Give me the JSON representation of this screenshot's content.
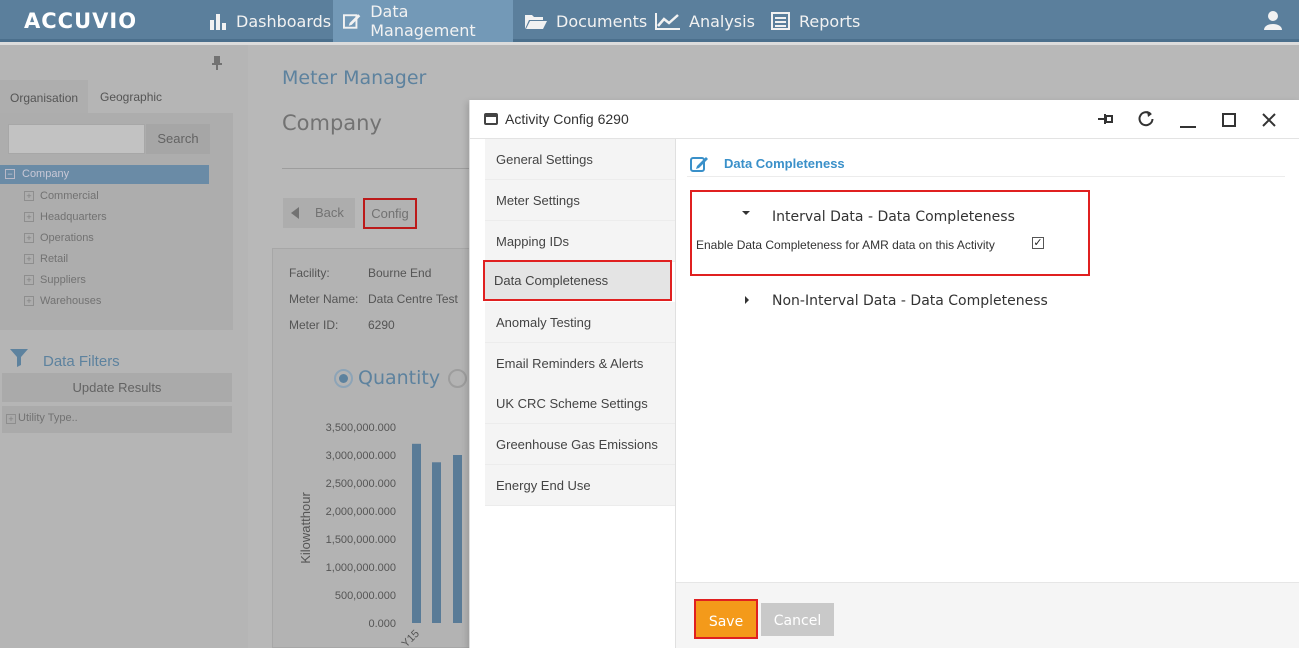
{
  "app": {
    "logo": "ACCUVIO"
  },
  "nav": {
    "items": [
      {
        "label": "Dashboards",
        "icon": "bar-chart-icon"
      },
      {
        "label": "Data Management",
        "icon": "edit-icon",
        "active": true
      },
      {
        "label": "Documents",
        "icon": "folder-open-icon"
      },
      {
        "label": "Analysis",
        "icon": "line-chart-icon"
      },
      {
        "label": "Reports",
        "icon": "report-list-icon"
      }
    ],
    "user_icon": "user-icon"
  },
  "left_panel": {
    "tabs": [
      "Organisation",
      "Geographic"
    ],
    "search_placeholder": "",
    "search_button": "Search",
    "tree": {
      "root": "Company",
      "children": [
        "Commercial",
        "Headquarters",
        "Operations",
        "Retail",
        "Suppliers",
        "Warehouses"
      ]
    },
    "filters_title": "Data Filters",
    "update_button": "Update Results",
    "utility_filter": "Utility Type.."
  },
  "main": {
    "title": "Meter Manager",
    "subtitle": "Company",
    "back_button": "Back",
    "config_button": "Config",
    "info": [
      {
        "label": "Facility:",
        "value": "Bourne End"
      },
      {
        "label": "Meter Name:",
        "value": "Data Centre Test"
      },
      {
        "label": "Meter ID:",
        "value": "6290"
      }
    ],
    "radio_quantity": "Quantity"
  },
  "chart_data": {
    "type": "bar",
    "ylabel": "Kilowatthour",
    "ylim": [
      0,
      3500000
    ],
    "yticks": [
      "3,500,000.000",
      "3,000,000.000",
      "2,500,000.000",
      "2,000,000.000",
      "1,500,000.000",
      "1,000,000.000",
      "500,000.000",
      "0.000"
    ],
    "xtick_partial": "Y15",
    "x_tick_2": "",
    "values": [
      3200000,
      2870000,
      3000000
    ]
  },
  "modal": {
    "title": "Activity Config 6290",
    "header_icons": [
      "pin-icon",
      "refresh-icon",
      "minimize-icon",
      "maximize-icon",
      "close-icon"
    ],
    "side_items": [
      "General Settings",
      "Meter Settings",
      "Mapping IDs",
      "Data Completeness",
      "Anomaly Testing",
      "Email Reminders & Alerts",
      "UK CRC Scheme Settings",
      "Greenhouse Gas Emissions",
      "Energy End Use"
    ],
    "selected_item": "Data Completeness",
    "section_title": "Data Completeness",
    "interval_title": "Interval Data - Data Completeness",
    "enable_label": "Enable Data Completeness for AMR data on this Activity",
    "enable_checked": true,
    "non_interval_title": "Non-Interval Data - Data Completeness",
    "save_button": "Save",
    "cancel_button": "Cancel"
  }
}
